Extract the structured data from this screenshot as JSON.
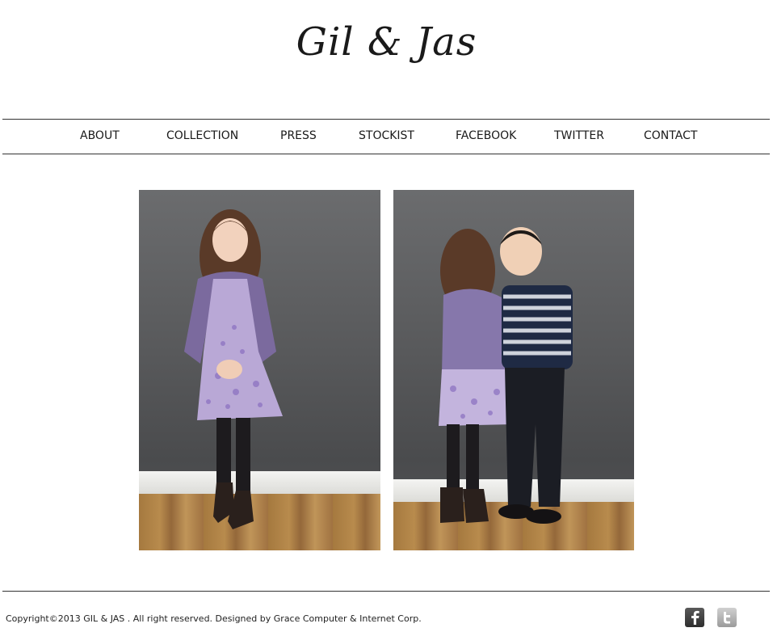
{
  "header": {
    "logo_text": "Gil & Jas"
  },
  "nav": {
    "items": [
      "ABOUT",
      "COLLECTION",
      "PRESS",
      "STOCKIST",
      "FACEBOOK",
      "TWITTER",
      "CONTACT"
    ]
  },
  "footer": {
    "copyright": "Copyright©2013 GIL & JAS . All right reserved.  Designed by Grace Computer & Internet Corp."
  },
  "social": {
    "icons": [
      "facebook-icon",
      "twitter-icon"
    ]
  },
  "colors": {
    "text": "#1a1a1a",
    "rule": "#333333",
    "background": "#ffffff"
  }
}
